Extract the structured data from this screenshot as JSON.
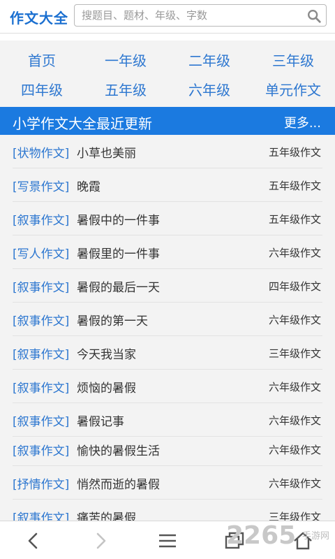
{
  "header": {
    "logo": "作文大全",
    "search_placeholder": "搜题目、题材、年级、字数"
  },
  "nav": {
    "items": [
      {
        "label": "首页"
      },
      {
        "label": "一年级"
      },
      {
        "label": "二年级"
      },
      {
        "label": "三年级"
      },
      {
        "label": "四年级"
      },
      {
        "label": "五年级"
      },
      {
        "label": "六年级"
      },
      {
        "label": "单元作文"
      }
    ]
  },
  "section": {
    "title": "小学作文大全最近更新",
    "more": "更多..."
  },
  "list": [
    {
      "category": "[状物作文]",
      "title": "小草也美丽",
      "grade": "五年级作文"
    },
    {
      "category": "[写景作文]",
      "title": "晚霞",
      "grade": "五年级作文"
    },
    {
      "category": "[叙事作文]",
      "title": "暑假中的一件事",
      "grade": "五年级作文"
    },
    {
      "category": "[写人作文]",
      "title": "暑假里的一件事",
      "grade": "六年级作文"
    },
    {
      "category": "[叙事作文]",
      "title": "暑假的最后一天",
      "grade": "四年级作文"
    },
    {
      "category": "[叙事作文]",
      "title": "暑假的第一天",
      "grade": "六年级作文"
    },
    {
      "category": "[叙事作文]",
      "title": "今天我当家",
      "grade": "三年级作文"
    },
    {
      "category": "[叙事作文]",
      "title": "烦恼的暑假",
      "grade": "六年级作文"
    },
    {
      "category": "[叙事作文]",
      "title": "暑假记事",
      "grade": "六年级作文"
    },
    {
      "category": "[叙事作文]",
      "title": "愉快的暑假生活",
      "grade": "六年级作文"
    },
    {
      "category": "[抒情作文]",
      "title": "悄然而逝的暑假",
      "grade": "六年级作文"
    },
    {
      "category": "[叙事作文]",
      "title": "痛苦的暑假",
      "grade": "三年级作文"
    }
  ],
  "bottom_bar": {
    "icons": [
      "back-arrow-icon",
      "forward-arrow-icon",
      "menu-icon",
      "windows-icon",
      "home-icon"
    ]
  },
  "watermark": {
    "number": "2265",
    "text": "手游网"
  },
  "colors": {
    "accent": "#1b7ae0",
    "link": "#2d77d0",
    "nav_bg": "#f3f3f3"
  }
}
